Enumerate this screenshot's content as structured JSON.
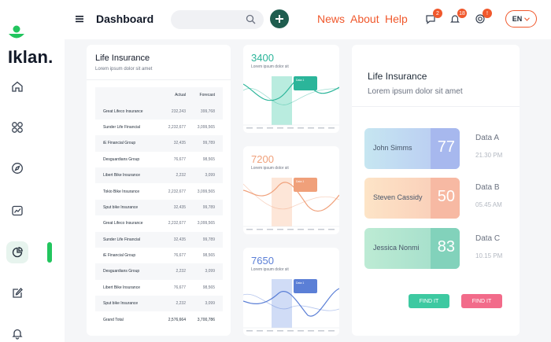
{
  "brand": {
    "name": "Iklan.",
    "accent": "#22c55e"
  },
  "header": {
    "title": "Dashboard",
    "search_placeholder": "",
    "links": [
      "News",
      "About",
      "Help"
    ],
    "badges": [
      "2",
      "18",
      "!"
    ],
    "language": "EN"
  },
  "sidebar": {
    "items": [
      "home-icon",
      "grid-icon",
      "compass-icon",
      "chart-icon",
      "pie-chart-icon",
      "edit-icon",
      "bell-icon"
    ]
  },
  "table_card": {
    "title": "Life Insurance",
    "subtitle": "Lorem ipsum dolor sit amet",
    "columns": [
      "",
      "Actual",
      "Forecast"
    ],
    "rows": [
      [
        "Great Lifeco Insurance",
        "232,243",
        "399,768"
      ],
      [
        "Sunder Life Financial",
        "2,232,677",
        "3,099,565"
      ],
      [
        "iE Financial Group",
        "32,435",
        "99,789"
      ],
      [
        "Desguardians Group",
        "76,677",
        "98,565"
      ],
      [
        "Libert Bike Insurance",
        "2,232",
        "3,099"
      ],
      [
        "Tokio Bike Insurance",
        "2,232,677",
        "3,099,565"
      ],
      [
        "Sput bike Insurance",
        "32,435",
        "99,789"
      ],
      [
        "Great Lifeco Insurance",
        "2,232,677",
        "3,099,565"
      ],
      [
        "Sunder Life Financial",
        "32,435",
        "99,789"
      ],
      [
        "iE Financial Group",
        "76,677",
        "98,565"
      ],
      [
        "Desguardians Group",
        "2,232",
        "3,099"
      ],
      [
        "Libert Bike Insurance",
        "76,677",
        "98,565"
      ],
      [
        "Sput bike Insurance",
        "2,232",
        "3,099"
      ]
    ],
    "total": [
      "Grand Total",
      "2,576,664",
      "3,700,786"
    ]
  },
  "mini_charts": [
    {
      "value": "3400",
      "subtitle": "Lorem ipsum dolor sit",
      "color": "#2bb59a",
      "highlight": "#7fdcc4",
      "tag": "Data 1"
    },
    {
      "value": "7200",
      "subtitle": "Lorem ipsum dolor sit",
      "color": "#f0a07a",
      "highlight": "#fbd2b8",
      "tag": "Data 1"
    },
    {
      "value": "7650",
      "subtitle": "Lorem ipsum dolor sit",
      "color": "#5b7fd6",
      "highlight": "#a9c0ef",
      "tag": "Data 1"
    }
  ],
  "right_card": {
    "title": "Life Insurance",
    "subtitle": "Lorem ipsum dolor sit amet",
    "people": [
      {
        "name": "John Simms",
        "value": "77",
        "label": "Data A",
        "time": "21.30 PM"
      },
      {
        "name": "Steven Cassidy",
        "value": "50",
        "label": "Data B",
        "time": "05.45 AM"
      },
      {
        "name": "Jessica Nonmi",
        "value": "83",
        "label": "Data C",
        "time": "10.15 PM"
      }
    ],
    "buttons": [
      "FIND IT",
      "FIND IT"
    ]
  }
}
